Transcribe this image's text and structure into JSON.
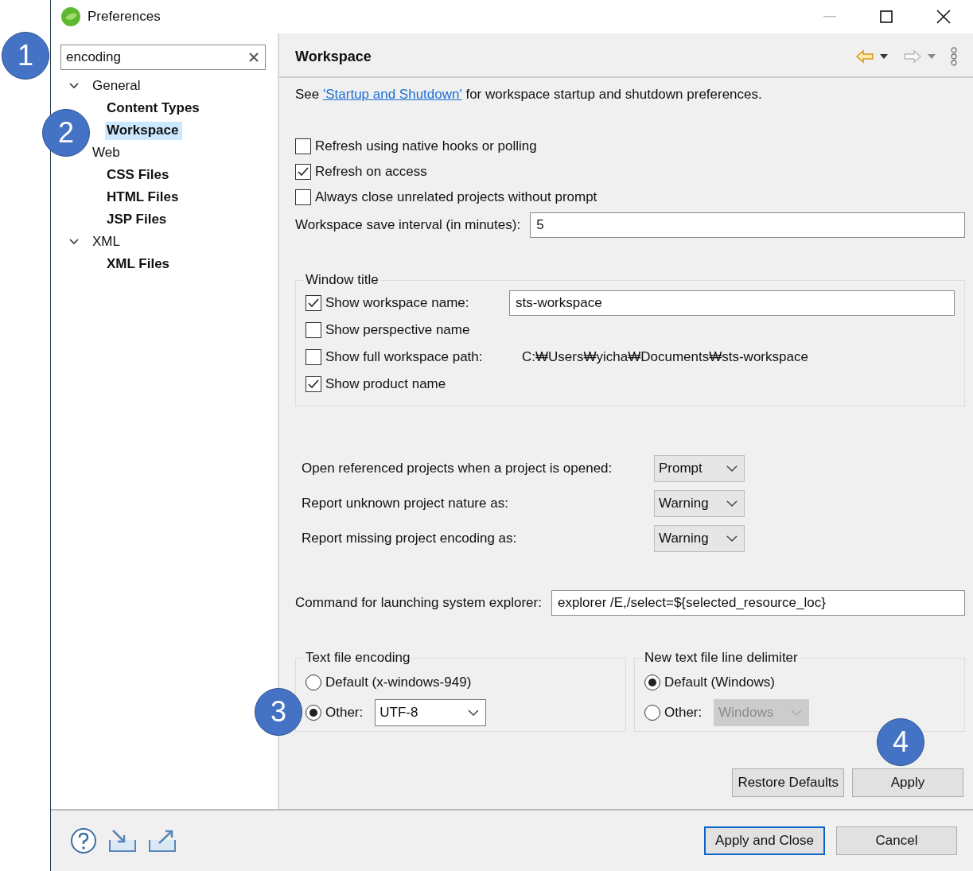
{
  "window": {
    "title": "Preferences"
  },
  "filter": {
    "value": "encoding"
  },
  "tree": [
    {
      "label": "General",
      "expanded": true,
      "selected": false,
      "children": [
        {
          "label": "Content Types",
          "selected": false
        },
        {
          "label": "Workspace",
          "selected": true
        }
      ]
    },
    {
      "label": "Web",
      "expanded": true,
      "selected": false,
      "children": [
        {
          "label": "CSS Files",
          "selected": false
        },
        {
          "label": "HTML Files",
          "selected": false
        },
        {
          "label": "JSP Files",
          "selected": false
        }
      ]
    },
    {
      "label": "XML",
      "expanded": true,
      "selected": false,
      "children": [
        {
          "label": "XML Files",
          "selected": false
        }
      ]
    }
  ],
  "page": {
    "title": "Workspace",
    "intro_before": "See",
    "link": "'Startup and Shutdown'",
    "intro_after": "for workspace startup and shutdown preferences."
  },
  "options": [
    {
      "label": "Refresh using native hooks or polling",
      "checked": false
    },
    {
      "label": "Refresh on access",
      "checked": true
    },
    {
      "label": "Always close unrelated projects without prompt",
      "checked": false
    }
  ],
  "save_interval": {
    "label": "Workspace save interval (in minutes):",
    "value": "5"
  },
  "window_title_group": {
    "title": "Window title",
    "rows": [
      {
        "kind": "field",
        "label": "Show workspace name:",
        "checked": true,
        "value": "sts-workspace"
      },
      {
        "kind": "plain",
        "label": "Show perspective name",
        "checked": false
      },
      {
        "kind": "path",
        "label": "Show full workspace path:",
        "checked": false,
        "value": "C:₩Users₩yicha₩Documents₩sts-workspace"
      },
      {
        "kind": "plain",
        "label": "Show product name",
        "checked": true
      }
    ]
  },
  "project_settings": [
    {
      "label": "Open referenced projects when a project is opened:",
      "value": "Prompt"
    },
    {
      "label": "Report unknown project nature as:",
      "value": "Warning"
    },
    {
      "label": "Report missing project encoding as:",
      "value": "Warning"
    }
  ],
  "explorer_command": {
    "label": "Command for launching system explorer:",
    "value": "explorer /E,/select=${selected_resource_loc}"
  },
  "encoding_group": {
    "title": "Text file encoding",
    "options": [
      {
        "label": "Default (x-windows-949)",
        "selected": false
      },
      {
        "label": "Other:",
        "selected": true,
        "value": "UTF-8",
        "disabled": false
      }
    ]
  },
  "delimiter_group": {
    "title": "New text file line delimiter",
    "options": [
      {
        "label": "Default (Windows)",
        "selected": true
      },
      {
        "label": "Other:",
        "selected": false,
        "value": "Windows",
        "disabled": true
      }
    ]
  },
  "page_buttons": [
    "Restore Defaults",
    "Apply"
  ],
  "dialog_buttons": [
    {
      "label": "Apply and Close",
      "default": true
    },
    {
      "label": "Cancel",
      "default": false
    }
  ],
  "callouts": [
    "1",
    "2",
    "3",
    "4"
  ]
}
